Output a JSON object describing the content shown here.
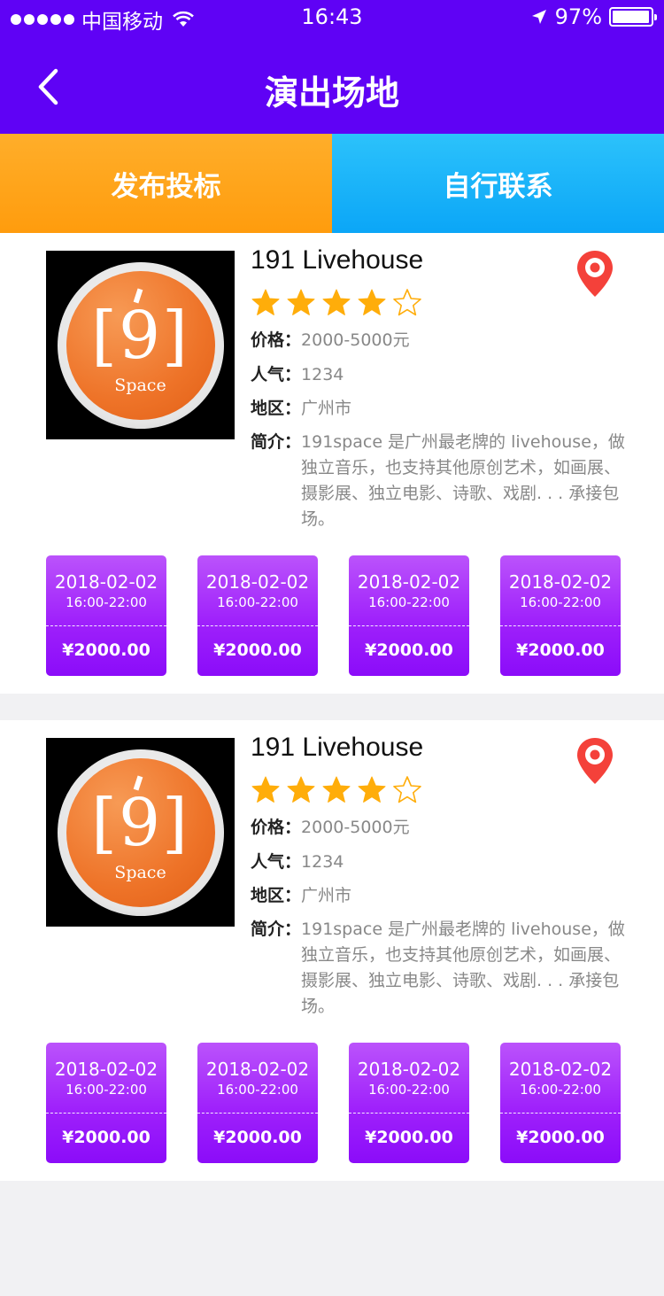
{
  "status_bar": {
    "carrier": "中国移动",
    "time": "16:43",
    "battery": "97%",
    "battery_level": 0.97
  },
  "header": {
    "title": "演出场地"
  },
  "actions": {
    "bid_label": "发布投标",
    "contact_label": "自行联系"
  },
  "colors": {
    "header": "#5f02f5",
    "bid": "#ff9c0d",
    "contact": "#0ba6f7",
    "slot": "#9f21fb",
    "star": "#ffad0a"
  },
  "venues": [
    {
      "name": "191 Livehouse",
      "logo_text": "[9]",
      "logo_sub": "Space",
      "rating": 4,
      "rating_max": 5,
      "price_label": "价格：",
      "price": "2000-5000元",
      "popularity_label": "人气：",
      "popularity": "1234",
      "region_label": "地区：",
      "region": "广州市",
      "intro_label": "简介：",
      "intro": "191space 是广州最老牌的 livehouse，做独立音乐，也支持其他原创艺术，如画展、摄影展、独立电影、诗歌、戏剧. . . 承接包场。",
      "slots": [
        {
          "date": "2018-02-02",
          "time": "16:00-22:00",
          "price": "¥2000.00"
        },
        {
          "date": "2018-02-02",
          "time": "16:00-22:00",
          "price": "¥2000.00"
        },
        {
          "date": "2018-02-02",
          "time": "16:00-22:00",
          "price": "¥2000.00"
        },
        {
          "date": "2018-02-02",
          "time": "16:00-22:00",
          "price": "¥2000.00"
        }
      ]
    },
    {
      "name": "191 Livehouse",
      "logo_text": "[9]",
      "logo_sub": "Space",
      "rating": 4,
      "rating_max": 5,
      "price_label": "价格：",
      "price": "2000-5000元",
      "popularity_label": "人气：",
      "popularity": "1234",
      "region_label": "地区：",
      "region": "广州市",
      "intro_label": "简介：",
      "intro": "191space 是广州最老牌的 livehouse，做独立音乐，也支持其他原创艺术，如画展、摄影展、独立电影、诗歌、戏剧. . . 承接包场。",
      "slots": [
        {
          "date": "2018-02-02",
          "time": "16:00-22:00",
          "price": "¥2000.00"
        },
        {
          "date": "2018-02-02",
          "time": "16:00-22:00",
          "price": "¥2000.00"
        },
        {
          "date": "2018-02-02",
          "time": "16:00-22:00",
          "price": "¥2000.00"
        },
        {
          "date": "2018-02-02",
          "time": "16:00-22:00",
          "price": "¥2000.00"
        }
      ]
    }
  ]
}
